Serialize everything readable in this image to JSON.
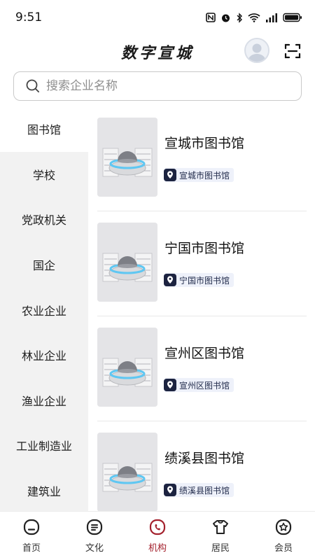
{
  "status_bar": {
    "time": "9:51"
  },
  "header": {
    "title": "数字宣城"
  },
  "search": {
    "placeholder": "搜索企业名称"
  },
  "sidebar": {
    "items": [
      {
        "label": "图书馆",
        "active": true
      },
      {
        "label": "学校"
      },
      {
        "label": "党政机关"
      },
      {
        "label": "国企"
      },
      {
        "label": "农业企业"
      },
      {
        "label": "林业企业"
      },
      {
        "label": "渔业企业"
      },
      {
        "label": "工业制造业"
      },
      {
        "label": "建筑业"
      }
    ]
  },
  "list": {
    "items": [
      {
        "name": "宣城市图书馆",
        "tag": "宣城市图书馆"
      },
      {
        "name": "宁国市图书馆",
        "tag": "宁国市图书馆"
      },
      {
        "name": "宣州区图书馆",
        "tag": "宣州区图书馆"
      },
      {
        "name": "绩溪县图书馆",
        "tag": "绩溪县图书馆"
      }
    ]
  },
  "tabbar": {
    "items": [
      {
        "label": "首页",
        "icon": "home-icon"
      },
      {
        "label": "文化",
        "icon": "culture-icon"
      },
      {
        "label": "机构",
        "icon": "institution-icon",
        "active": true
      },
      {
        "label": "居民",
        "icon": "resident-icon"
      },
      {
        "label": "会员",
        "icon": "member-icon"
      }
    ]
  },
  "colors": {
    "accent": "#a3202c",
    "sidebar_bg": "#f2f2f2",
    "tag_bg": "#eef1fa"
  }
}
